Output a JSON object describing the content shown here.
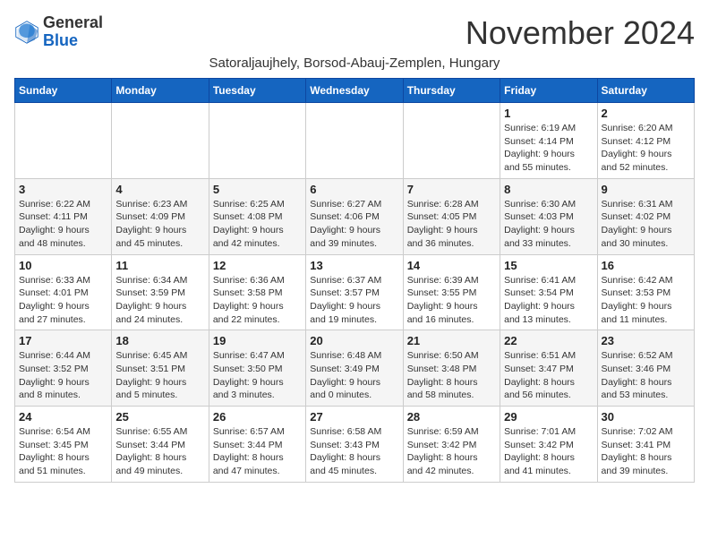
{
  "logo": {
    "general": "General",
    "blue": "Blue"
  },
  "header": {
    "month_title": "November 2024",
    "subtitle": "Satoraljaujhely, Borsod-Abauj-Zemplen, Hungary"
  },
  "weekdays": [
    "Sunday",
    "Monday",
    "Tuesday",
    "Wednesday",
    "Thursday",
    "Friday",
    "Saturday"
  ],
  "weeks": [
    [
      {
        "day": "",
        "info": ""
      },
      {
        "day": "",
        "info": ""
      },
      {
        "day": "",
        "info": ""
      },
      {
        "day": "",
        "info": ""
      },
      {
        "day": "",
        "info": ""
      },
      {
        "day": "1",
        "info": "Sunrise: 6:19 AM\nSunset: 4:14 PM\nDaylight: 9 hours\nand 55 minutes."
      },
      {
        "day": "2",
        "info": "Sunrise: 6:20 AM\nSunset: 4:12 PM\nDaylight: 9 hours\nand 52 minutes."
      }
    ],
    [
      {
        "day": "3",
        "info": "Sunrise: 6:22 AM\nSunset: 4:11 PM\nDaylight: 9 hours\nand 48 minutes."
      },
      {
        "day": "4",
        "info": "Sunrise: 6:23 AM\nSunset: 4:09 PM\nDaylight: 9 hours\nand 45 minutes."
      },
      {
        "day": "5",
        "info": "Sunrise: 6:25 AM\nSunset: 4:08 PM\nDaylight: 9 hours\nand 42 minutes."
      },
      {
        "day": "6",
        "info": "Sunrise: 6:27 AM\nSunset: 4:06 PM\nDaylight: 9 hours\nand 39 minutes."
      },
      {
        "day": "7",
        "info": "Sunrise: 6:28 AM\nSunset: 4:05 PM\nDaylight: 9 hours\nand 36 minutes."
      },
      {
        "day": "8",
        "info": "Sunrise: 6:30 AM\nSunset: 4:03 PM\nDaylight: 9 hours\nand 33 minutes."
      },
      {
        "day": "9",
        "info": "Sunrise: 6:31 AM\nSunset: 4:02 PM\nDaylight: 9 hours\nand 30 minutes."
      }
    ],
    [
      {
        "day": "10",
        "info": "Sunrise: 6:33 AM\nSunset: 4:01 PM\nDaylight: 9 hours\nand 27 minutes."
      },
      {
        "day": "11",
        "info": "Sunrise: 6:34 AM\nSunset: 3:59 PM\nDaylight: 9 hours\nand 24 minutes."
      },
      {
        "day": "12",
        "info": "Sunrise: 6:36 AM\nSunset: 3:58 PM\nDaylight: 9 hours\nand 22 minutes."
      },
      {
        "day": "13",
        "info": "Sunrise: 6:37 AM\nSunset: 3:57 PM\nDaylight: 9 hours\nand 19 minutes."
      },
      {
        "day": "14",
        "info": "Sunrise: 6:39 AM\nSunset: 3:55 PM\nDaylight: 9 hours\nand 16 minutes."
      },
      {
        "day": "15",
        "info": "Sunrise: 6:41 AM\nSunset: 3:54 PM\nDaylight: 9 hours\nand 13 minutes."
      },
      {
        "day": "16",
        "info": "Sunrise: 6:42 AM\nSunset: 3:53 PM\nDaylight: 9 hours\nand 11 minutes."
      }
    ],
    [
      {
        "day": "17",
        "info": "Sunrise: 6:44 AM\nSunset: 3:52 PM\nDaylight: 9 hours\nand 8 minutes."
      },
      {
        "day": "18",
        "info": "Sunrise: 6:45 AM\nSunset: 3:51 PM\nDaylight: 9 hours\nand 5 minutes."
      },
      {
        "day": "19",
        "info": "Sunrise: 6:47 AM\nSunset: 3:50 PM\nDaylight: 9 hours\nand 3 minutes."
      },
      {
        "day": "20",
        "info": "Sunrise: 6:48 AM\nSunset: 3:49 PM\nDaylight: 9 hours\nand 0 minutes."
      },
      {
        "day": "21",
        "info": "Sunrise: 6:50 AM\nSunset: 3:48 PM\nDaylight: 8 hours\nand 58 minutes."
      },
      {
        "day": "22",
        "info": "Sunrise: 6:51 AM\nSunset: 3:47 PM\nDaylight: 8 hours\nand 56 minutes."
      },
      {
        "day": "23",
        "info": "Sunrise: 6:52 AM\nSunset: 3:46 PM\nDaylight: 8 hours\nand 53 minutes."
      }
    ],
    [
      {
        "day": "24",
        "info": "Sunrise: 6:54 AM\nSunset: 3:45 PM\nDaylight: 8 hours\nand 51 minutes."
      },
      {
        "day": "25",
        "info": "Sunrise: 6:55 AM\nSunset: 3:44 PM\nDaylight: 8 hours\nand 49 minutes."
      },
      {
        "day": "26",
        "info": "Sunrise: 6:57 AM\nSunset: 3:44 PM\nDaylight: 8 hours\nand 47 minutes."
      },
      {
        "day": "27",
        "info": "Sunrise: 6:58 AM\nSunset: 3:43 PM\nDaylight: 8 hours\nand 45 minutes."
      },
      {
        "day": "28",
        "info": "Sunrise: 6:59 AM\nSunset: 3:42 PM\nDaylight: 8 hours\nand 42 minutes."
      },
      {
        "day": "29",
        "info": "Sunrise: 7:01 AM\nSunset: 3:42 PM\nDaylight: 8 hours\nand 41 minutes."
      },
      {
        "day": "30",
        "info": "Sunrise: 7:02 AM\nSunset: 3:41 PM\nDaylight: 8 hours\nand 39 minutes."
      }
    ]
  ]
}
